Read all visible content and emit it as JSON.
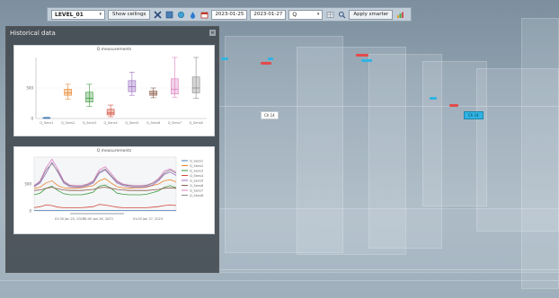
{
  "toolbar": {
    "level_select": "LEVEL_01",
    "show_ceilings": "Show ceilings",
    "date_from": "2023-01-25",
    "date_to": "2023-01-27",
    "range_select": "Q",
    "apply_label": "Apply smarter"
  },
  "panel": {
    "title": "Historical data",
    "charts": [
      {
        "title": "Q measurements",
        "type": "box",
        "ylim": [
          0,
          1000
        ],
        "ytick_labels": [
          "0",
          "500"
        ],
        "categories": [
          "Q_Sens1",
          "Q_Sens2",
          "Q_Sens3",
          "Q_Sens4",
          "Q_Sens5",
          "Q_Sens6",
          "Q_Sens7",
          "Q_Sens8"
        ],
        "boxes": [
          {
            "min": 0,
            "q1": 5,
            "median": 10,
            "q3": 15,
            "max": 20,
            "color": "#4a7fb5"
          },
          {
            "min": 320,
            "q1": 380,
            "median": 420,
            "q3": 480,
            "max": 560,
            "color": "#e8862e"
          },
          {
            "min": 200,
            "q1": 270,
            "median": 330,
            "q3": 430,
            "max": 560,
            "color": "#3e9a3e"
          },
          {
            "min": 30,
            "q1": 60,
            "median": 90,
            "q3": 150,
            "max": 220,
            "color": "#d24a3a"
          },
          {
            "min": 380,
            "q1": 440,
            "median": 520,
            "q3": 620,
            "max": 760,
            "color": "#9b6cc0"
          },
          {
            "min": 340,
            "q1": 380,
            "median": 410,
            "q3": 450,
            "max": 500,
            "color": "#8b5a4a"
          },
          {
            "min": 350,
            "q1": 400,
            "median": 480,
            "q3": 650,
            "max": 1000,
            "color": "#de7fbf"
          },
          {
            "min": 330,
            "q1": 420,
            "median": 500,
            "q3": 680,
            "max": 1000,
            "color": "#8a8a8a"
          }
        ]
      },
      {
        "title": "Q measurements",
        "type": "line",
        "ylim": [
          0,
          1000
        ],
        "ytick_labels": [
          "0",
          "500"
        ],
        "xtick_labels": [
          "01:00 Jan 25, 2023",
          "01:00 Jan 26, 2023",
          "01:00 Jan 27, 2023"
        ],
        "series": [
          {
            "name": "Q_Sens1",
            "color": "#4a7fb5",
            "values": [
              10,
              10,
              10,
              10,
              10,
              10,
              10,
              10,
              10,
              10,
              10,
              10,
              10,
              10,
              10,
              10,
              10,
              10,
              10,
              10,
              10,
              10,
              10,
              10,
              10
            ]
          },
          {
            "name": "Q_Sens2",
            "color": "#e8862e",
            "values": [
              420,
              440,
              520,
              560,
              470,
              430,
              420,
              420,
              430,
              450,
              470,
              560,
              600,
              520,
              450,
              430,
              420,
              430,
              430,
              440,
              470,
              500,
              560,
              580,
              540
            ]
          },
          {
            "name": "Q_Sens3",
            "color": "#3e9a3e",
            "values": [
              300,
              330,
              420,
              460,
              380,
              320,
              300,
              300,
              300,
              320,
              350,
              460,
              480,
              420,
              330,
              310,
              300,
              300,
              300,
              310,
              340,
              370,
              440,
              470,
              430
            ]
          },
          {
            "name": "Q_Sens4",
            "color": "#d24a3a",
            "values": [
              60,
              80,
              110,
              100,
              70,
              60,
              60,
              60,
              60,
              70,
              80,
              120,
              110,
              90,
              70,
              60,
              60,
              60,
              60,
              60,
              70,
              80,
              100,
              110,
              100
            ]
          },
          {
            "name": "Q_Sens5",
            "color": "#9b6cc0",
            "values": [
              450,
              520,
              700,
              900,
              720,
              520,
              450,
              440,
              440,
              470,
              520,
              700,
              760,
              640,
              520,
              470,
              450,
              440,
              440,
              450,
              480,
              560,
              680,
              720,
              660
            ]
          },
          {
            "name": "Q_Sens6",
            "color": "#8b5a4a",
            "values": [
              380,
              390,
              420,
              440,
              410,
              390,
              380,
              380,
              380,
              390,
              400,
              430,
              440,
              420,
              400,
              390,
              380,
              380,
              380,
              380,
              390,
              400,
              420,
              430,
              420
            ]
          },
          {
            "name": "Q_Sens7",
            "color": "#de7fbf",
            "values": [
              470,
              560,
              800,
              960,
              780,
              560,
              480,
              470,
              470,
              500,
              560,
              760,
              820,
              700,
              560,
              500,
              480,
              470,
              470,
              480,
              520,
              600,
              740,
              780,
              720
            ]
          },
          {
            "name": "Q_Sens8",
            "color": "#8a8a8a",
            "values": [
              460,
              540,
              760,
              880,
              740,
              540,
              470,
              460,
              460,
              490,
              540,
              720,
              780,
              660,
              540,
              490,
              470,
              460,
              460,
              470,
              510,
              580,
              700,
              760,
              700
            ]
          }
        ]
      }
    ]
  },
  "scene": {
    "labels": [
      "Ch 14"
    ],
    "badge": "Ch 14"
  }
}
